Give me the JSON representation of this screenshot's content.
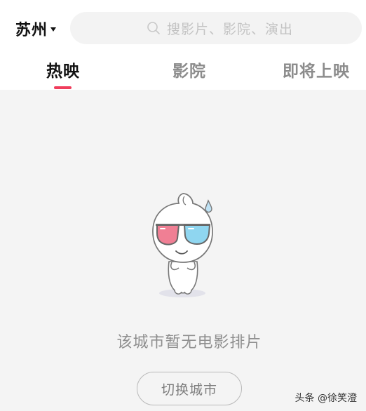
{
  "header": {
    "city": "苏州",
    "search_placeholder": "搜影片、影院、演出"
  },
  "tabs": [
    {
      "label": "热映",
      "active": true
    },
    {
      "label": "影院",
      "active": false
    },
    {
      "label": "即将上映",
      "active": false
    }
  ],
  "empty_state": {
    "message": "该城市暂无电影排片",
    "button_label": "切换城市"
  },
  "watermark": "头条 @徐笑澄",
  "colors": {
    "accent": "#f03d5c",
    "glasses_red": "#f07f94",
    "glasses_blue": "#8fd6f0"
  },
  "icons": {
    "search": "search-icon",
    "caret": "caret-down-icon",
    "mascot": "mascot-illustration"
  }
}
